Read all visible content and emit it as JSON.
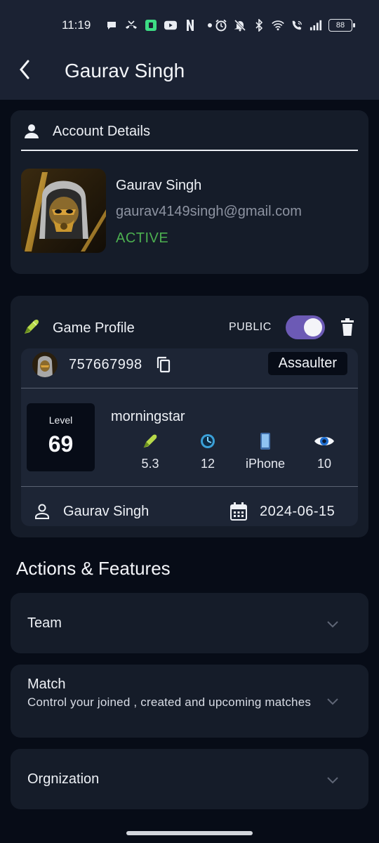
{
  "status_bar": {
    "time": "11:19",
    "battery": "88",
    "left_icons": [
      "chat-bubble-icon",
      "missed-call-icon",
      "app-notification-icon",
      "youtube-icon",
      "netflix-icon",
      "dot-icon"
    ],
    "right_icons": [
      "alarm-icon",
      "mute-bell-icon",
      "bluetooth-icon",
      "wifi-icon",
      "wifi-calling-icon",
      "signal-icon"
    ]
  },
  "appbar": {
    "title": "Gaurav Singh"
  },
  "account": {
    "header": "Account Details",
    "name": "Gaurav Singh",
    "email": "gaurav4149singh@gmail.com",
    "status": "ACTIVE",
    "status_color": "#4caf50"
  },
  "game_profile": {
    "header": "Game Profile",
    "visibility_label": "PUBLIC",
    "visibility_on": true,
    "game_id": "757667998",
    "role": "Assaulter",
    "level_label": "Level",
    "level": "69",
    "ign": "morningstar",
    "stats": [
      {
        "icon": "bullet-icon",
        "value": "5.3"
      },
      {
        "icon": "timer-icon",
        "value": "12"
      },
      {
        "icon": "phone-icon",
        "value": "iPhone"
      },
      {
        "icon": "eye-icon",
        "value": "10"
      }
    ],
    "owner": "Gaurav Singh",
    "date": "2024-06-15"
  },
  "actions": {
    "title": "Actions & Features",
    "items": [
      {
        "title": "Team",
        "subtitle": ""
      },
      {
        "title": "Match",
        "subtitle": "Control your joined , created and upcoming matches"
      },
      {
        "title": "Orgnization",
        "subtitle": ""
      }
    ]
  },
  "colors": {
    "background": "#070c17",
    "card": "#151c29",
    "accent": "#6c5ab5"
  }
}
